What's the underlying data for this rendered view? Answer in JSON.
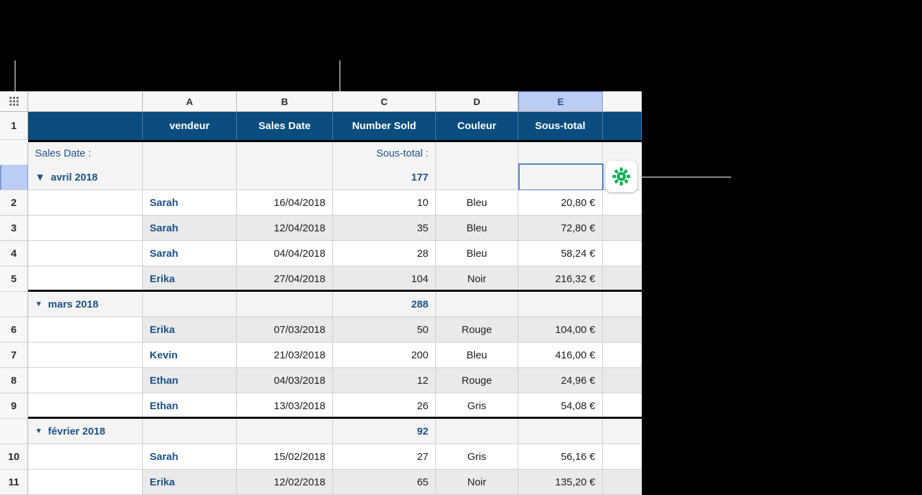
{
  "app": {
    "name": "numbers-spreadsheet",
    "accent_blue": "#1a5288",
    "header_fill": "#0a4d7e",
    "selection_blue": "#b9cdf5",
    "gear_green": "#00b050"
  },
  "sheet": {
    "corner_handle": "table-handle-icon",
    "column_letters": [
      "",
      "A",
      "B",
      "C",
      "D",
      "E",
      ""
    ],
    "selected_column": "E",
    "header_row_number": "1",
    "header_row": [
      "",
      "vendeur",
      "Sales Date",
      "Number Sold",
      "Couleur",
      "Sous-total",
      ""
    ],
    "category_header": {
      "label_top": "Sales Date :",
      "label_bottom": "avril 2018",
      "disclosure_icon": "triangle-down-icon",
      "subtotal_label": "Sous-total :",
      "subtotal_value": "177",
      "selected_cell_column": "E",
      "selected_cell_value": ""
    },
    "groups": [
      {
        "name": "avril 2018",
        "summary_number_sold": "177",
        "rows": [
          {
            "num": "2",
            "vendeur": "Sarah",
            "sales_date": "16/04/2018",
            "number_sold": "10",
            "couleur": "Bleu",
            "sous_total": "20,80 €",
            "banded": false
          },
          {
            "num": "3",
            "vendeur": "Sarah",
            "sales_date": "12/04/2018",
            "number_sold": "35",
            "couleur": "Bleu",
            "sous_total": "72,80 €",
            "banded": true
          },
          {
            "num": "4",
            "vendeur": "Sarah",
            "sales_date": "04/04/2018",
            "number_sold": "28",
            "couleur": "Bleu",
            "sous_total": "58,24 €",
            "banded": false
          },
          {
            "num": "5",
            "vendeur": "Erika",
            "sales_date": "27/04/2018",
            "number_sold": "104",
            "couleur": "Noir",
            "sous_total": "216,32 €",
            "banded": true
          }
        ]
      },
      {
        "name": "mars 2018",
        "summary_number_sold": "288",
        "rows": [
          {
            "num": "6",
            "vendeur": "Erika",
            "sales_date": "07/03/2018",
            "number_sold": "50",
            "couleur": "Rouge",
            "sous_total": "104,00 €",
            "banded": true
          },
          {
            "num": "7",
            "vendeur": "Kevin",
            "sales_date": "21/03/2018",
            "number_sold": "200",
            "couleur": "Bleu",
            "sous_total": "416,00 €",
            "banded": false
          },
          {
            "num": "8",
            "vendeur": "Ethan",
            "sales_date": "04/03/2018",
            "number_sold": "12",
            "couleur": "Rouge",
            "sous_total": "24,96 €",
            "banded": true
          },
          {
            "num": "9",
            "vendeur": "Ethan",
            "sales_date": "13/03/2018",
            "number_sold": "26",
            "couleur": "Gris",
            "sous_total": "54,08 €",
            "banded": false
          }
        ]
      },
      {
        "name": "février 2018",
        "summary_number_sold": "92",
        "rows": [
          {
            "num": "10",
            "vendeur": "Sarah",
            "sales_date": "15/02/2018",
            "number_sold": "27",
            "couleur": "Gris",
            "sous_total": "56,16 €",
            "banded": false
          },
          {
            "num": "11",
            "vendeur": "Erika",
            "sales_date": "12/02/2018",
            "number_sold": "65",
            "couleur": "Noir",
            "sous_total": "135,20 €",
            "banded": true
          }
        ]
      }
    ]
  },
  "callouts": [
    {
      "id": "callout-category-row",
      "target": "category-row-selector"
    },
    {
      "id": "callout-subtotal",
      "target": "subtotal-value-177"
    },
    {
      "id": "callout-gear",
      "target": "cell-format-gear-button"
    }
  ],
  "gear_button": {
    "icon": "gear-icon",
    "label": ""
  }
}
